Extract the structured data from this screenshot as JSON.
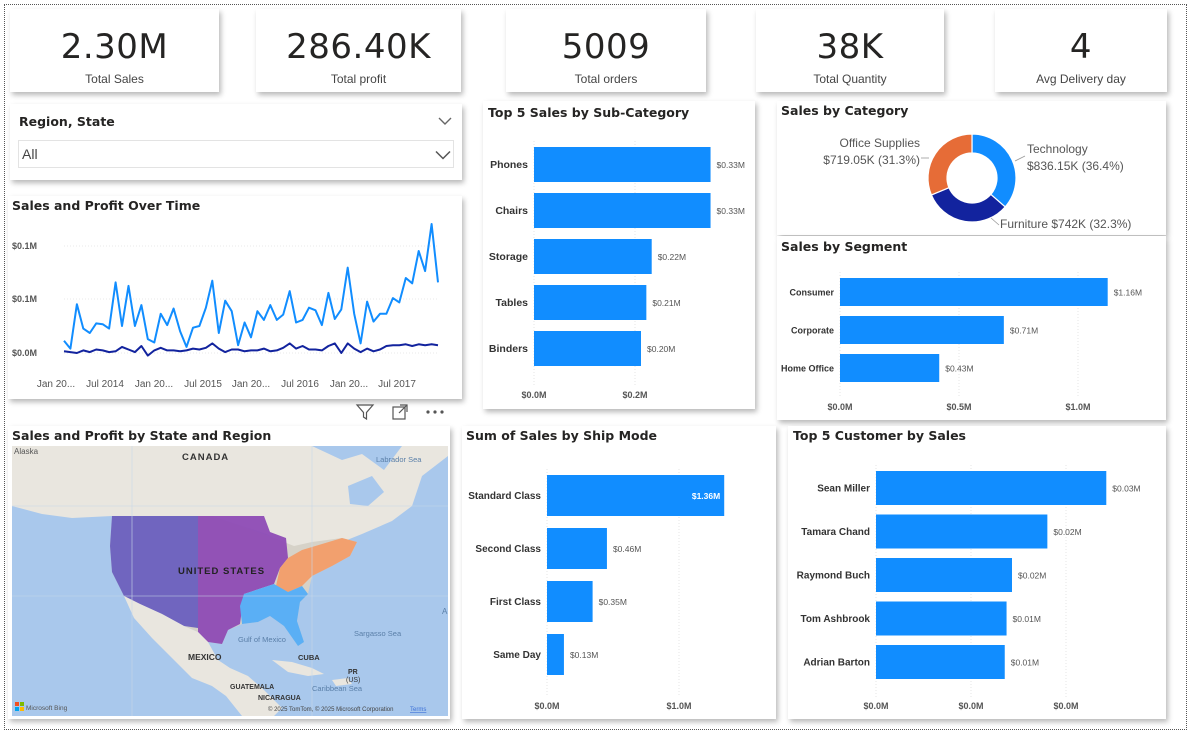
{
  "kpis": [
    {
      "value": "2.30M",
      "label": "Total Sales"
    },
    {
      "value": "286.40K",
      "label": "Total profit"
    },
    {
      "value": "5009",
      "label": "Total orders"
    },
    {
      "value": "38K",
      "label": "Total Quantity"
    },
    {
      "value": "4",
      "label": "Avg Delivery day"
    }
  ],
  "slicer": {
    "title": "Region, State",
    "value": "All"
  },
  "colors": {
    "bar": "#118DFF",
    "dark_blue": "#12239E",
    "orange": "#E66C37",
    "purple": "#744EC2",
    "magenta": "#8E4BB5",
    "salmon": "#F2A06E",
    "light_blue": "#5AAFF5"
  },
  "icons": {
    "filter": "filter-icon",
    "focus": "focus-mode-icon",
    "more": "more-options-icon",
    "chevron": "chevron-down-icon"
  },
  "chart_data": [
    {
      "type": "line",
      "title": "Sales and Profit Over Time",
      "x_tick_labels": [
        "Jan 20...",
        "Jul 2014",
        "Jan 20...",
        "Jul 2015",
        "Jan 20...",
        "Jul 2016",
        "Jan 20...",
        "Jul 2017"
      ],
      "y_tick_labels": [
        "$0.1M",
        "$0.1M",
        "$0.0M"
      ],
      "ylim": [
        0,
        0.12
      ],
      "series": [
        {
          "values": [
            0.014,
            0.005,
            0.056,
            0.028,
            0.023,
            0.034,
            0.033,
            0.028,
            0.081,
            0.031,
            0.077,
            0.031,
            0.055,
            0.016,
            0.012,
            0.045,
            0.032,
            0.051,
            0.025,
            0.007,
            0.029,
            0.031,
            0.052,
            0.083,
            0.023,
            0.06,
            0.048,
            0.009,
            0.035,
            0.018,
            0.048,
            0.038,
            0.055,
            0.038,
            0.044,
            0.071,
            0.035,
            0.038,
            0.052,
            0.049,
            0.032,
            0.069,
            0.039,
            0.05,
            0.098,
            0.045,
            0.011,
            0.059,
            0.036,
            0.045,
            0.045,
            0.063,
            0.058,
            0.086,
            0.08,
            0.117,
            0.094,
            0.148,
            0.081
          ]
        },
        {
          "values": [
            0.002,
            0.001,
            0.0,
            0.003,
            0.001,
            0.004,
            0.003,
            0.001,
            0.002,
            0.007,
            0.004,
            0.001,
            0.008,
            -0.003,
            0.003,
            0.006,
            0.003,
            0.003,
            0.002,
            0.003,
            0.005,
            0.004,
            0.006,
            0.011,
            0.005,
            0.001,
            0.004,
            0.004,
            0.002,
            0.003,
            0.003,
            0.005,
            0.002,
            0.003,
            0.006,
            0.011,
            0.005,
            0.008,
            0.004,
            0.004,
            0.003,
            0.008,
            0.011,
            0.0,
            0.011,
            0.005,
            0.001,
            0.005,
            0.002,
            0.004,
            0.008,
            0.009,
            0.009,
            0.01,
            0.008,
            0.01,
            0.009,
            0.01,
            0.009
          ]
        }
      ]
    },
    {
      "type": "bar",
      "title": "Top 5 Sales by Sub-Category",
      "categories": [
        "Phones",
        "Chairs",
        "Storage",
        "Tables",
        "Binders"
      ],
      "values": [
        0.33,
        0.33,
        0.22,
        0.21,
        0.2
      ],
      "labels": [
        "$0.33M",
        "$0.33M",
        "$0.22M",
        "$0.21M",
        "$0.20M"
      ],
      "x_tick_labels": [
        "$0.0M",
        "$0.2M"
      ],
      "xlim": [
        0,
        0.4
      ]
    },
    {
      "type": "pie",
      "title": "Sales by Category",
      "slices": [
        {
          "name": "Technology",
          "value": 836.15,
          "label": "$836.15K (36.4%)"
        },
        {
          "name": "Furniture",
          "value": 742,
          "label": "$742K (32.3%)"
        },
        {
          "name": "Office Supplies",
          "value": 719.05,
          "label": "$719.05K (31.3%)"
        }
      ]
    },
    {
      "type": "bar",
      "title": "Sales by Segment",
      "categories": [
        "Consumer",
        "Corporate",
        "Home Office"
      ],
      "values": [
        1.16,
        0.71,
        0.43
      ],
      "labels": [
        "$1.16M",
        "$0.71M",
        "$0.43M"
      ],
      "x_tick_labels": [
        "$0.0M",
        "$0.5M",
        "$1.0M"
      ],
      "xlim": [
        0,
        1.3
      ]
    },
    {
      "type": "bar",
      "title": "Sum of Sales by Ship Mode",
      "categories": [
        "Standard Class",
        "Second Class",
        "First Class",
        "Same Day"
      ],
      "values": [
        1.36,
        0.46,
        0.35,
        0.13
      ],
      "labels": [
        "$1.36M",
        "$0.46M",
        "$0.35M",
        "$0.13M"
      ],
      "x_tick_labels": [
        "$0.0M",
        "$1.0M"
      ],
      "xlim": [
        0,
        1.65
      ]
    },
    {
      "type": "bar",
      "title": "Top 5 Customer by Sales",
      "categories": [
        "Sean Miller",
        "Tamara Chand",
        "Raymond Buch",
        "Tom Ashbrook",
        "Adrian Barton"
      ],
      "values": [
        0.0254,
        0.0189,
        0.015,
        0.0144,
        0.0142
      ],
      "labels": [
        "$0.03M",
        "$0.02M",
        "$0.02M",
        "$0.01M",
        "$0.01M"
      ],
      "x_tick_labels": [
        "$0.0M",
        "$0.0M",
        "$0.0M"
      ],
      "xlim": [
        0,
        0.03
      ]
    }
  ],
  "map": {
    "title": "Sales and Profit by State and Region",
    "labels": [
      "Alaska",
      "CANADA",
      "Labrador Sea",
      "UNITED STATES",
      "Gulf of Mexico",
      "Sargasso Sea",
      "MEXICO",
      "CUBA",
      "PR",
      "(US)",
      "GUATEMALA",
      "Caribbean Sea",
      "NICARAGUA",
      "A"
    ],
    "attribution": "© 2025 TomTom, © 2025 Microsoft Corporation",
    "terms": "Terms",
    "brand": "Microsoft Bing"
  }
}
